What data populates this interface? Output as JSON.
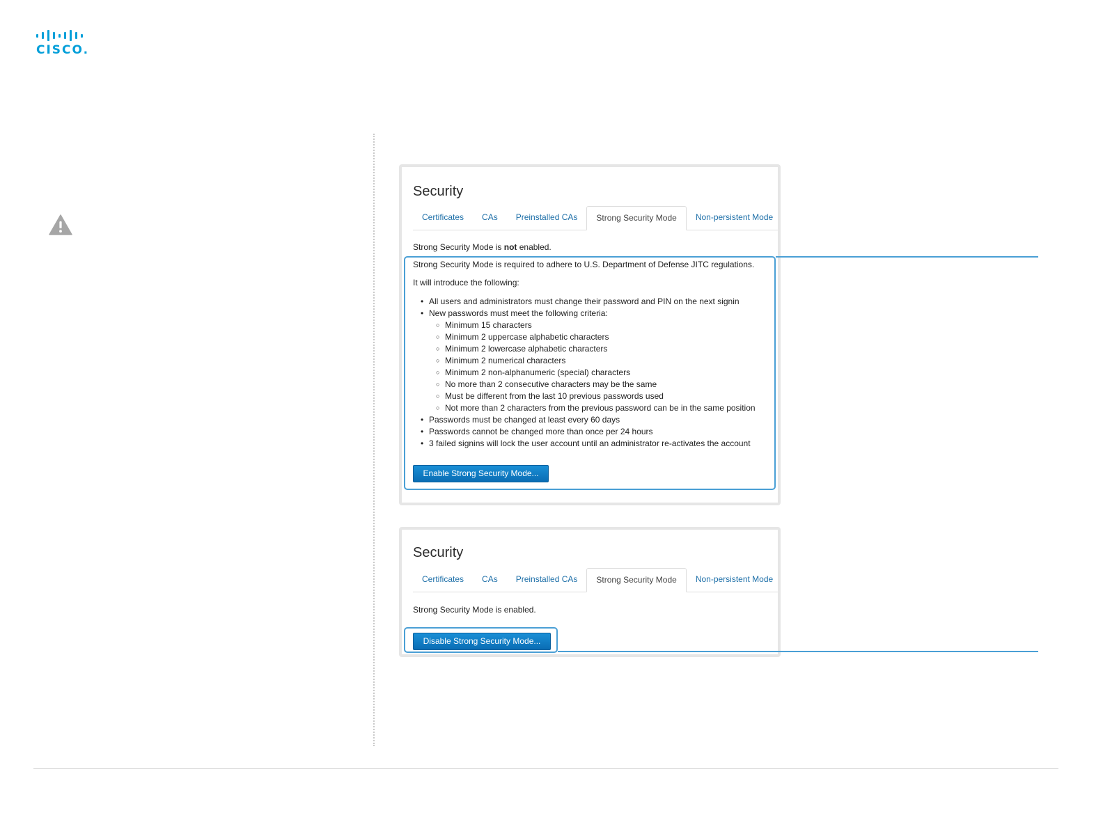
{
  "logo": {
    "text": "CISCO."
  },
  "warning_icon": "warning-triangle-icon",
  "panel_enable": {
    "title": "Security",
    "tabs": [
      {
        "label": "Certificates",
        "active": false
      },
      {
        "label": "CAs",
        "active": false
      },
      {
        "label": "Preinstalled CAs",
        "active": false
      },
      {
        "label": "Strong Security Mode",
        "active": true
      },
      {
        "label": "Non-persistent Mode",
        "active": false
      }
    ],
    "status_prefix": "Strong Security Mode is ",
    "status_bold": "not",
    "status_suffix": " enabled.",
    "intro": "Strong Security Mode is required to adhere to U.S. Department of Defense JITC regulations.",
    "intro2": "It will introduce the following:",
    "bullets": {
      "b1": "All users and administrators must change their password and PIN on the next signin",
      "b2": "New passwords must meet the following criteria:",
      "criteria": [
        "Minimum 15 characters",
        "Minimum 2 uppercase alphabetic characters",
        "Minimum 2 lowercase alphabetic characters",
        "Minimum 2 numerical characters",
        "Minimum 2 non-alphanumeric (special) characters",
        "No more than 2 consecutive characters may be the same",
        "Must be different from the last 10 previous passwords used",
        "Not more than 2 characters from the previous password can be in the same position"
      ],
      "b3": "Passwords must be changed at least every 60 days",
      "b4": "Passwords cannot be changed more than once per 24 hours",
      "b5": "3 failed signins will lock the user account until an administrator re-activates the account"
    },
    "button_label": "Enable Strong Security Mode..."
  },
  "panel_disable": {
    "title": "Security",
    "tabs": [
      {
        "label": "Certificates",
        "active": false
      },
      {
        "label": "CAs",
        "active": false
      },
      {
        "label": "Preinstalled CAs",
        "active": false
      },
      {
        "label": "Strong Security Mode",
        "active": true
      },
      {
        "label": "Non-persistent Mode",
        "active": false
      }
    ],
    "status": "Strong Security Mode is enabled.",
    "button_label": "Disable Strong Security Mode..."
  },
  "colors": {
    "brand": "#049fd9",
    "highlight": "#4a9fd5",
    "button": "#0a6db4",
    "link": "#1d6fa8"
  }
}
